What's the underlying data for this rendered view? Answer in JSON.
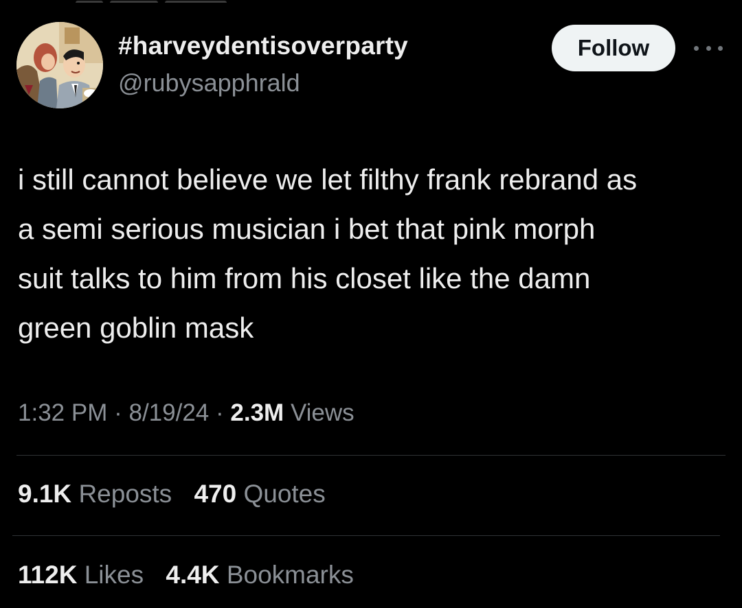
{
  "colors": {
    "background": "#000000",
    "primary_text": "#eeeeee",
    "secondary_text": "#8b9096",
    "divider": "#2f3336",
    "follow_button_bg": "#eff3f4",
    "follow_button_text": "#0f1419"
  },
  "author": {
    "avatar_icon": "profile-avatar-cartoon",
    "display_name": "#harveydentisoverparty",
    "handle": "@rubysapphrald"
  },
  "header": {
    "follow_label": "Follow",
    "more_icon": "more-options-icon"
  },
  "tweet": {
    "text": "i still cannot believe we let filthy frank rebrand as\na semi serious musician i bet that pink morph\nsuit talks to him from his closet like the damn\ngreen goblin mask"
  },
  "meta": {
    "time": "1:32 PM",
    "separator": "·",
    "date": "8/19/24",
    "views_count": "2.3M",
    "views_label": "Views"
  },
  "stats": {
    "reposts_count": "9.1K",
    "reposts_label": "Reposts",
    "quotes_count": "470",
    "quotes_label": "Quotes",
    "likes_count": "112K",
    "likes_label": "Likes",
    "bookmarks_count": "4.4K",
    "bookmarks_label": "Bookmarks"
  }
}
